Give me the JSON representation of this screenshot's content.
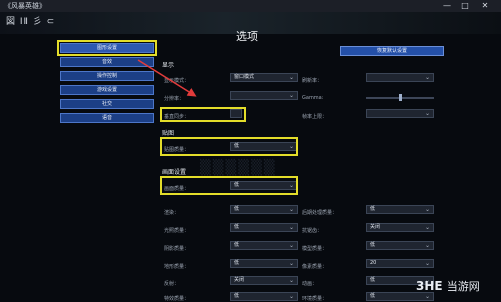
{
  "window": {
    "title": "《风暴英雄》",
    "minimize": "—",
    "maximize": "□",
    "close": "✕"
  },
  "logo": "図 ⅠⅡ 彡 ⊂",
  "sidebar": {
    "items": [
      {
        "label": "图形设置"
      },
      {
        "label": "音效"
      },
      {
        "label": "操作控制"
      },
      {
        "label": "游戏设置"
      },
      {
        "label": "社交"
      },
      {
        "label": "语音"
      }
    ]
  },
  "page_title": "选项",
  "reset_button": "恢复默认设置",
  "display": {
    "section": "显示",
    "mode_label": "显示模式：",
    "mode_value": "窗口模式",
    "resolution_label": "分辨率：",
    "refresh_label": "刷新率：",
    "gamma_label": "Gamma:",
    "sync_label": "垂直同步：",
    "limit_label": "帧率上限："
  },
  "texture": {
    "section": "贴图",
    "quality_label": "贴图质量：",
    "quality_value": "低"
  },
  "graphics": {
    "section": "画面设置",
    "quality_label": "画面质量：",
    "quality_value": "低"
  },
  "details": {
    "left": [
      {
        "label": "渲染：",
        "value": "低"
      },
      {
        "label": "光照质量：",
        "value": "低"
      },
      {
        "label": "阴影质量：",
        "value": "低"
      },
      {
        "label": "地形质量：",
        "value": "低"
      },
      {
        "label": "反射：",
        "value": "关闭"
      },
      {
        "label": "特效质量：",
        "value": "低"
      }
    ],
    "right": [
      {
        "label": "后期处理质量：",
        "value": "低"
      },
      {
        "label": "抗锯齿：",
        "value": "关闭"
      },
      {
        "label": "模型质量：",
        "value": "低"
      },
      {
        "label": "像素质量：",
        "value": "20"
      },
      {
        "label": "动画：",
        "value": "低"
      },
      {
        "label": "环境质量：",
        "value": "低"
      }
    ]
  },
  "watermark": {
    "brand": "3HE",
    "text": "当游网"
  },
  "colors": {
    "highlight": "#e3dd2a",
    "button": "#1c3f86",
    "arrow": "#e23b3b"
  }
}
